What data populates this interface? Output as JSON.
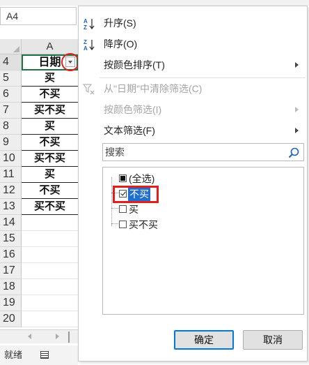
{
  "sheet": {
    "name_box": "A4",
    "column_header": "A",
    "rows": [
      {
        "num": "4",
        "value": "日期"
      },
      {
        "num": "5",
        "value": "买"
      },
      {
        "num": "6",
        "value": "不买"
      },
      {
        "num": "7",
        "value": "买不买"
      },
      {
        "num": "8",
        "value": "买"
      },
      {
        "num": "9",
        "value": "不买"
      },
      {
        "num": "10",
        "value": "买不买"
      },
      {
        "num": "11",
        "value": "买"
      },
      {
        "num": "12",
        "value": "不买"
      },
      {
        "num": "13",
        "value": "买不买"
      },
      {
        "num": "14",
        "value": ""
      },
      {
        "num": "15",
        "value": ""
      },
      {
        "num": "16",
        "value": ""
      },
      {
        "num": "17",
        "value": ""
      },
      {
        "num": "18",
        "value": ""
      },
      {
        "num": "19",
        "value": ""
      },
      {
        "num": "20",
        "value": ""
      }
    ],
    "status": "就绪"
  },
  "menu": {
    "sort_asc": "升序(S)",
    "sort_desc": "降序(O)",
    "sort_by_color": "按颜色排序(T)",
    "clear_filter": "从\"日期\"中清除筛选(C)",
    "filter_by_color": "按颜色筛选(I)",
    "text_filter": "文本筛选(F)",
    "search_placeholder": "搜索",
    "items": [
      {
        "label": "(全选)",
        "state": "partial"
      },
      {
        "label": "不买",
        "state": "checked"
      },
      {
        "label": "买",
        "state": "unchecked"
      },
      {
        "label": "买不买",
        "state": "unchecked"
      }
    ],
    "ok": "确定",
    "cancel": "取消"
  },
  "colors": {
    "annotation_red": "#e0201c",
    "selection_blue": "#1f6fd1",
    "sort_icon_blue": "#1f5fbf"
  }
}
